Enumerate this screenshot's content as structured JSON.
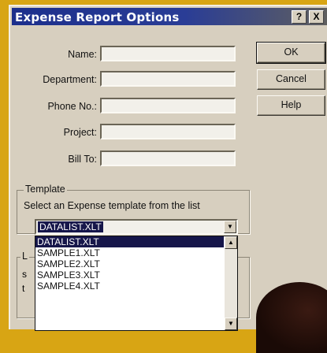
{
  "window": {
    "title": "Expense Report Options",
    "help_glyph": "?",
    "close_glyph": "X"
  },
  "fields": [
    {
      "label": "Name:",
      "value": ""
    },
    {
      "label": "Department:",
      "value": ""
    },
    {
      "label": "Phone No.:",
      "value": ""
    },
    {
      "label": "Project:",
      "value": ""
    },
    {
      "label": "Bill To:",
      "value": ""
    }
  ],
  "buttons": {
    "ok": "OK",
    "cancel": "Cancel",
    "help": "Help"
  },
  "template_group": {
    "legend": "Template",
    "instruction": "Select an Expense template from the list",
    "selected": "DATALIST.XLT",
    "options": [
      "DATALIST.XLT",
      "SAMPLE1.XLT",
      "SAMPLE2.XLT",
      "SAMPLE3.XLT",
      "SAMPLE4.XLT"
    ]
  },
  "obscured_group": {
    "legend_fragment": "L",
    "line_fragments": [
      "s",
      "t"
    ]
  },
  "icons": {
    "combo_arrow": "triangle-down",
    "scroll_up": "triangle-up",
    "scroll_down": "triangle-down"
  },
  "colors": {
    "title_bar": "#1c2f8c",
    "dialog_bg": "#d7cfbf",
    "selection": "#16164a",
    "background": "#d8a514"
  }
}
